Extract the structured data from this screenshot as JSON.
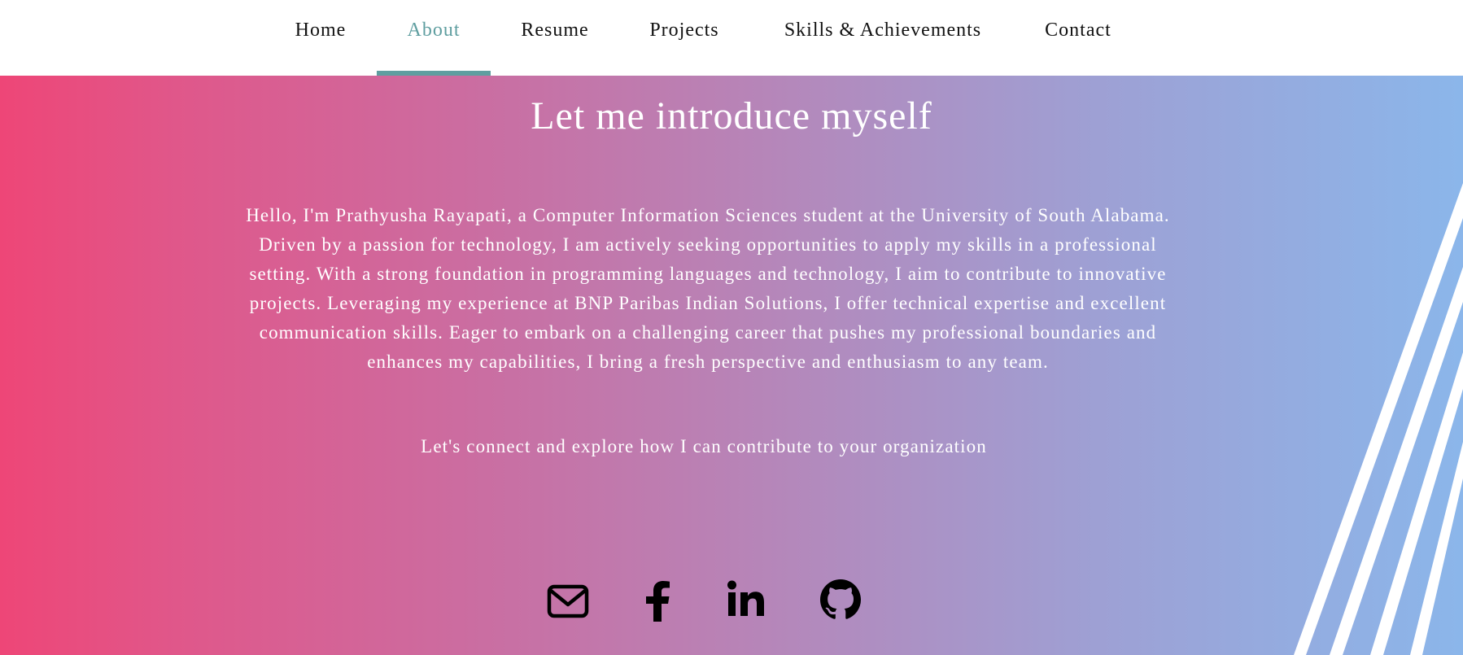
{
  "nav": {
    "items": [
      {
        "label": "Home"
      },
      {
        "label": "About",
        "active": true
      },
      {
        "label": "Resume"
      },
      {
        "label": "Projects"
      },
      {
        "label": "Skills & Achievements"
      },
      {
        "label": "Contact"
      }
    ]
  },
  "about": {
    "heading": "Let me introduce myself",
    "intro": "Hello, I'm Prathyusha Rayapati, a Computer Information Sciences student at the University of South Alabama. Driven by a passion for technology, I am actively seeking opportunities to apply my skills in a professional setting. With a strong foundation in programming languages and technology, I aim to contribute to innovative projects. Leveraging my experience at BNP Paribas Indian Solutions, I offer technical expertise and excellent communication skills. Eager to embark on a challenging career that pushes my professional boundaries and enhances my capabilities, I bring a fresh perspective and enthusiasm to any team.",
    "cta": "Let's connect and explore how I can contribute to your organization"
  },
  "socials": [
    {
      "icon": "envelope-icon"
    },
    {
      "icon": "facebook-icon"
    },
    {
      "icon": "linkedin-icon"
    },
    {
      "icon": "github-icon"
    }
  ],
  "colors": {
    "accent": "#5f9ea0",
    "gradient_start": "#ee4677",
    "gradient_end": "#8bb6ea"
  }
}
